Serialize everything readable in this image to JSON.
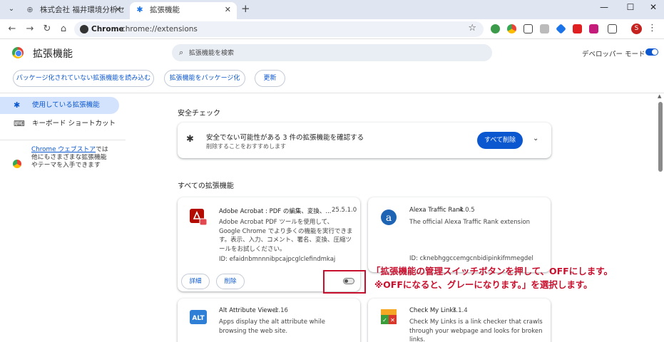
{
  "tabs": [
    {
      "title": "株式会社 福井環境分析セ",
      "active": false
    },
    {
      "title": "拡張機能",
      "active": true
    }
  ],
  "toolbar": {
    "site": "Chrome",
    "url": "chrome://extensions",
    "avatar": "S"
  },
  "header": {
    "title": "拡張機能",
    "search_placeholder": "拡張機能を検索",
    "dev_mode": "デベロッパー モード"
  },
  "actions": {
    "load_unpacked": "パッケージ化されていない拡張機能を読み込む",
    "pack": "拡張機能をパッケージ化",
    "update": "更新"
  },
  "sidebar": {
    "items": [
      {
        "label": "使用している拡張機能",
        "icon": "puzzle-icon",
        "active": true
      },
      {
        "label": "キーボード ショートカット",
        "icon": "keyboard-icon",
        "active": false
      }
    ],
    "store_link": "Chrome ウェブストア",
    "store_text": "では他にもさまざまな拡張機能やテーマを入手できます"
  },
  "safety": {
    "section_title": "安全チェック",
    "title": "安全でない可能性がある 3 件の拡張機能を確認する",
    "subtitle": "削除することをおすすめします",
    "remove_all": "すべて削除"
  },
  "all_title": "すべての拡張機能",
  "extensions": [
    {
      "name": "Adobe Acrobat : PDF の編集、変換、...",
      "version": "25.5.1.0",
      "description": "Adobe Acrobat PDF ツールを使用して、Google Chrome でより多くの機能を実行できます。表示、入力、コメント、署名、変換、圧縮ツールをお試しください。",
      "id": "ID: efaidnbmnnnibpcajpcglclefindmkaj",
      "details": "詳細",
      "remove": "削除",
      "enabled": false,
      "logo_color": "#b30b00"
    },
    {
      "name": "Alexa Traffic Rank",
      "version": "4.0.5",
      "description": "The official Alexa Traffic Rank extension",
      "id": "ID: cknebhggccemgcnbidipinkifmmegdel",
      "logo_color": "#1e64b4"
    },
    {
      "name": "Alt Attribute Viewer",
      "version": "1.16",
      "description": "Apps display the alt attribute while browsing the web site.",
      "logo_color": "#2f7fd6"
    },
    {
      "name": "Check My Links",
      "version": "7.1.4",
      "description": "Check My Links is a link checker that crawls through your webpage and looks for broken links.",
      "logo_color": "#f5a623"
    }
  ],
  "annotation": {
    "line1": "「拡張機能の管理スイッチボタンを押して、OFFにします。",
    "line2": "※OFFになると、グレーになります。」を選択します。"
  }
}
